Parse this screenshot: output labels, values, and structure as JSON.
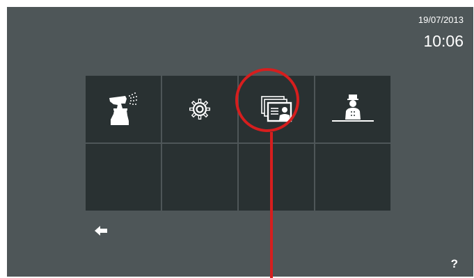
{
  "status": {
    "date": "19/07/2013",
    "time": "10:06"
  },
  "menu": {
    "tiles": [
      {
        "icon": "spray-bottle-icon"
      },
      {
        "icon": "gear-icon"
      },
      {
        "icon": "contact-cards-icon",
        "highlighted": true
      },
      {
        "icon": "concierge-icon"
      },
      {
        "icon": ""
      },
      {
        "icon": ""
      },
      {
        "icon": ""
      },
      {
        "icon": ""
      }
    ]
  },
  "nav": {
    "back_icon": "back-arrow-icon",
    "help_label": "?"
  },
  "annotation": {
    "color": "#d61e1e"
  },
  "colors": {
    "screen_bg": "#4e5658",
    "tile_bg": "#293132",
    "text": "#ffffff"
  }
}
